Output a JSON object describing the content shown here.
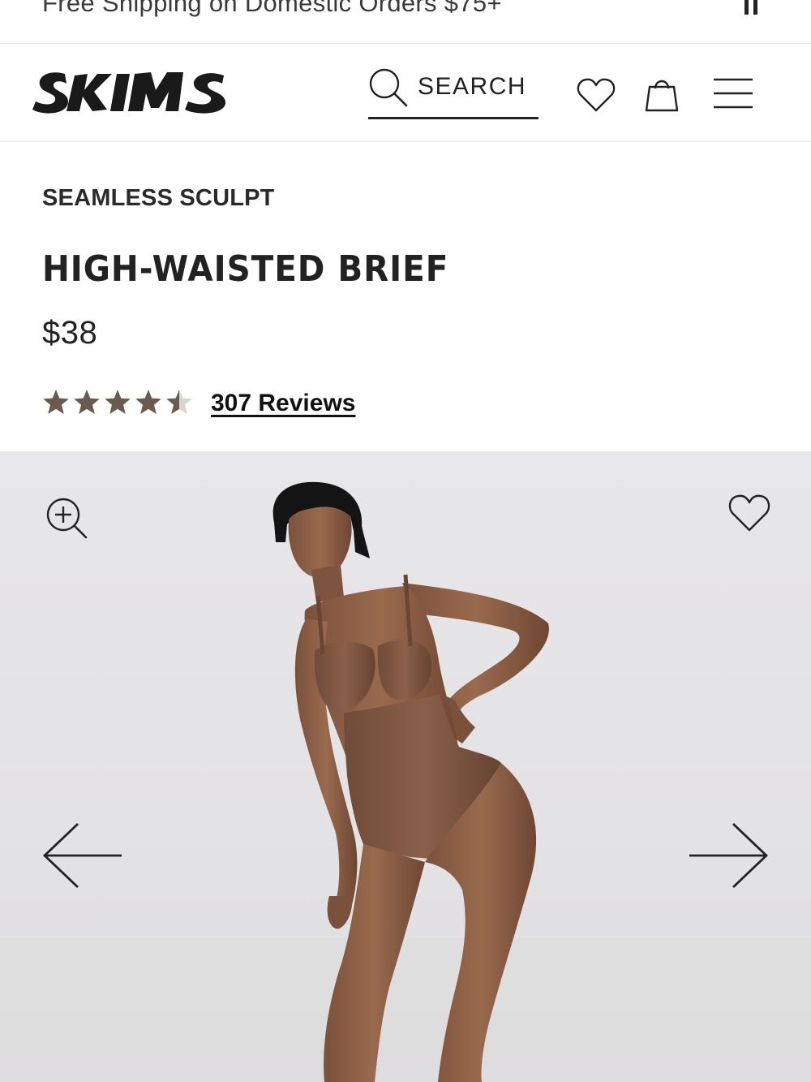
{
  "promo": {
    "text": "Free Shipping on Domestic Orders $75+"
  },
  "header": {
    "logo_text": "SKIMS",
    "search_label": "SEARCH"
  },
  "product": {
    "collection": "SEAMLESS SCULPT",
    "title": "HIGH-WAISTED BRIEF",
    "price": "$38",
    "rating": 4.5,
    "rating_max": 5,
    "reviews_label": "307 Reviews"
  },
  "colors": {
    "star": "#6b5a4e",
    "text": "#222222",
    "skin_garment": "#8a5e45"
  },
  "icons": [
    "pause-icon",
    "search-icon",
    "heart-icon",
    "bag-icon",
    "menu-icon",
    "zoom-in-icon",
    "arrow-left-icon",
    "arrow-right-icon"
  ]
}
